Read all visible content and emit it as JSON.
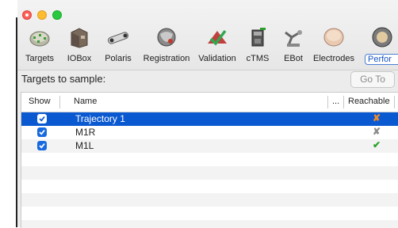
{
  "toolbar": {
    "items": [
      {
        "label": "Targets",
        "icon": "targets-icon"
      },
      {
        "label": "IOBox",
        "icon": "iobox-icon"
      },
      {
        "label": "Polaris",
        "icon": "polaris-icon"
      },
      {
        "label": "Registration",
        "icon": "registration-icon"
      },
      {
        "label": "Validation",
        "icon": "validation-icon"
      },
      {
        "label": "cTMS",
        "icon": "ctms-icon"
      },
      {
        "label": "EBot",
        "icon": "ebot-icon"
      },
      {
        "label": "Electrodes",
        "icon": "electrodes-icon"
      },
      {
        "label": "Perfor",
        "icon": "perform-icon",
        "active": true
      }
    ]
  },
  "header": {
    "targets_label": "Targets to sample:",
    "goto_label": "Go To"
  },
  "table": {
    "columns": {
      "show": "Show",
      "name": "Name",
      "more": "...",
      "reachable": "Reachable"
    },
    "rows": [
      {
        "name": "Trajectory 1",
        "show": true,
        "reachable": "✘",
        "reachable_color": "#f28c28",
        "selected": true
      },
      {
        "name": "M1R",
        "show": true,
        "reachable": "✘",
        "reachable_color": "#8c8c8c",
        "selected": false
      },
      {
        "name": "M1L",
        "show": true,
        "reachable": "✔",
        "reachable_color": "#27a327",
        "selected": false
      }
    ]
  },
  "colors": {
    "selection": "#0b59d1",
    "checkbox": "#1769e0",
    "accent": "#1a57c4"
  }
}
